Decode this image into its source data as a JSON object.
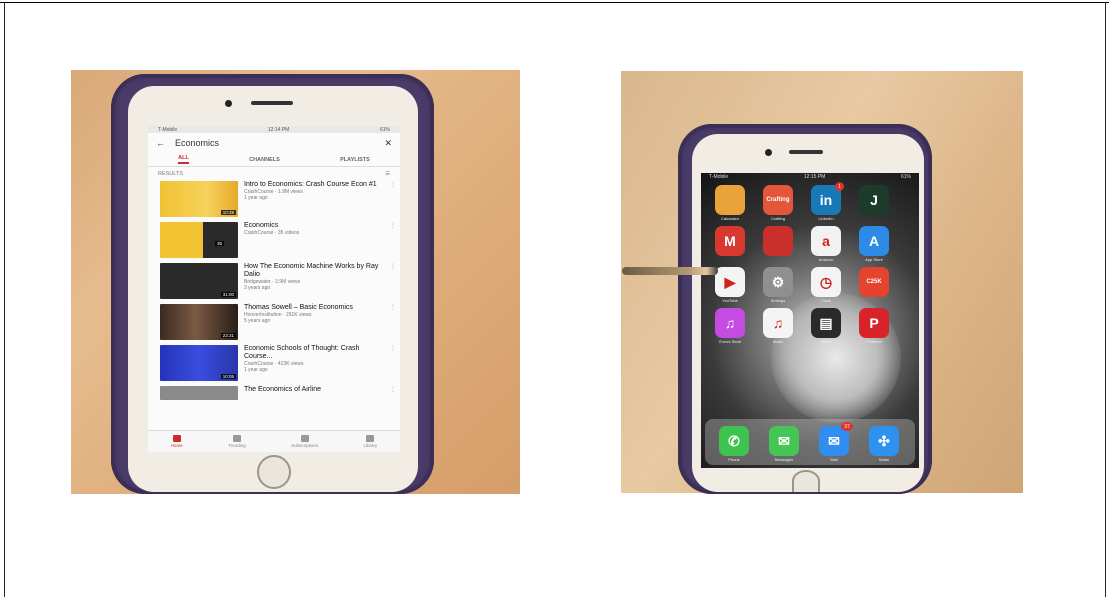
{
  "youtube_screen": {
    "search_query": "Economics",
    "tabs": [
      "ALL",
      "CHANNELS",
      "PLAYLISTS"
    ],
    "results_label": "RESULTS",
    "videos": [
      {
        "title": "Intro to Economics: Crash Course Econ #1",
        "channel": "CrashCourse · 1.9M views",
        "age": "1 year ago",
        "duration": "10:39"
      },
      {
        "title": "Economics",
        "channel": "CrashCourse · 35 videos",
        "age": "",
        "duration": "35"
      },
      {
        "title": "How The Economic Machine Works by Ray Dalio",
        "channel": "Bridgewater · 3.9M views",
        "age": "3 years ago",
        "duration": "31:00"
      },
      {
        "title": "Thomas Sowell – Basic Economics",
        "channel": "HooverInstitution · 291K views",
        "age": "5 years ago",
        "duration": "23:31"
      },
      {
        "title": "Economic Schools of Thought: Crash Course...",
        "channel": "CrashCourse · 423K views",
        "age": "1 year ago",
        "duration": "10:05"
      },
      {
        "title": "The Economics of Airline",
        "channel": "",
        "age": "",
        "duration": ""
      }
    ],
    "nav": [
      "Home",
      "Trending",
      "Subscriptions",
      "Library"
    ]
  },
  "home_screen": {
    "apps": [
      {
        "label": "Calculator",
        "glyph": "",
        "color": "#e9a33a"
      },
      {
        "label": "Crafting",
        "glyph": "Crafting",
        "color": "#e3563a"
      },
      {
        "label": "LinkedIn",
        "glyph": "in",
        "color": "#1878b8",
        "badge": "1"
      },
      {
        "label": "",
        "glyph": "J",
        "color": "#1d3b2a"
      },
      {
        "label": "",
        "glyph": "M",
        "color": "#d8382e"
      },
      {
        "label": "",
        "glyph": "",
        "color": "#c9302c"
      },
      {
        "label": "Amazon",
        "glyph": "a",
        "color": "#f2f2f2"
      },
      {
        "label": "App Store",
        "glyph": "A",
        "color": "#2b8be6"
      },
      {
        "label": "YouTube",
        "glyph": "▶",
        "color": "#f4f4f4"
      },
      {
        "label": "Settings",
        "glyph": "⚙",
        "color": "#8f8f8f"
      },
      {
        "label": "Clock",
        "glyph": "◷",
        "color": "#f4f4f4"
      },
      {
        "label": "",
        "glyph": "C25K",
        "color": "#e4442e"
      },
      {
        "label": "iTunes Store",
        "glyph": "♫",
        "color": "#c44ce0"
      },
      {
        "label": "Music",
        "glyph": "♫",
        "color": "#f4f4f4"
      },
      {
        "label": "Wallet",
        "glyph": "▤",
        "color": "#2a2a2a"
      },
      {
        "label": "Pinterest",
        "glyph": "P",
        "color": "#d8232a"
      }
    ],
    "dock": [
      {
        "label": "Phone",
        "glyph": "✆",
        "color": "#3ec34f"
      },
      {
        "label": "Messages",
        "glyph": "✉",
        "color": "#43c654"
      },
      {
        "label": "Mail",
        "glyph": "✉",
        "color": "#2f8ef0",
        "badge": "37"
      },
      {
        "label": "Safari",
        "glyph": "✣",
        "color": "#2d92ee"
      }
    ]
  }
}
